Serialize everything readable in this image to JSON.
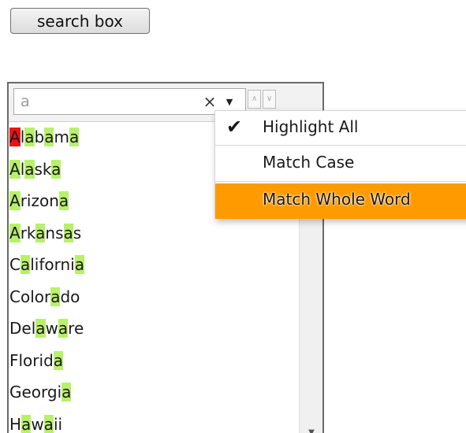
{
  "top_button": {
    "label": "search box"
  },
  "search": {
    "value": "a",
    "clear_label": "×",
    "options_label": "▼",
    "prev_label": "∧",
    "next_label": "∨"
  },
  "states": [
    {
      "segments": [
        [
          "A",
          "current"
        ],
        [
          "l",
          ""
        ],
        [
          "a",
          "hl"
        ],
        [
          "b",
          ""
        ],
        [
          "a",
          "hl"
        ],
        [
          "m",
          ""
        ],
        [
          "a",
          "hl"
        ]
      ]
    },
    {
      "segments": [
        [
          "A",
          "hl"
        ],
        [
          "l",
          ""
        ],
        [
          "a",
          "hl"
        ],
        [
          "sk",
          ""
        ],
        [
          "a",
          "hl"
        ]
      ]
    },
    {
      "segments": [
        [
          "A",
          "hl"
        ],
        [
          "rizon",
          ""
        ],
        [
          "a",
          "hl"
        ]
      ]
    },
    {
      "segments": [
        [
          "A",
          "hl"
        ],
        [
          "rk",
          ""
        ],
        [
          "a",
          "hl"
        ],
        [
          "ns",
          ""
        ],
        [
          "a",
          "hl"
        ],
        [
          "s",
          ""
        ]
      ]
    },
    {
      "segments": [
        [
          "C",
          ""
        ],
        [
          "a",
          "hl"
        ],
        [
          "liforni",
          ""
        ],
        [
          "a",
          "hl"
        ]
      ]
    },
    {
      "segments": [
        [
          "Color",
          ""
        ],
        [
          "a",
          "hl"
        ],
        [
          "do",
          ""
        ]
      ]
    },
    {
      "segments": [
        [
          "Del",
          ""
        ],
        [
          "a",
          "hl"
        ],
        [
          "w",
          ""
        ],
        [
          "a",
          "hl"
        ],
        [
          "re",
          ""
        ]
      ]
    },
    {
      "segments": [
        [
          "Florid",
          ""
        ],
        [
          "a",
          "hl"
        ]
      ]
    },
    {
      "segments": [
        [
          "Georgi",
          ""
        ],
        [
          "a",
          "hl"
        ]
      ]
    },
    {
      "segments": [
        [
          "H",
          ""
        ],
        [
          "a",
          "hl"
        ],
        [
          "w",
          ""
        ],
        [
          "a",
          "hl"
        ],
        [
          "ii",
          ""
        ]
      ]
    }
  ],
  "menu": {
    "items": [
      {
        "label": "Highlight All",
        "checked": true,
        "check_glyph": "✔"
      },
      {
        "label": "Match Case",
        "checked": false
      },
      {
        "label": "Match Whole Word",
        "checked": false,
        "hovered": true
      }
    ]
  },
  "colors": {
    "highlight": "#b8f06a",
    "current_match": "#ee1111",
    "menu_hover": "#ff9b00"
  },
  "scrollbar": {
    "down_icon": "▼"
  }
}
